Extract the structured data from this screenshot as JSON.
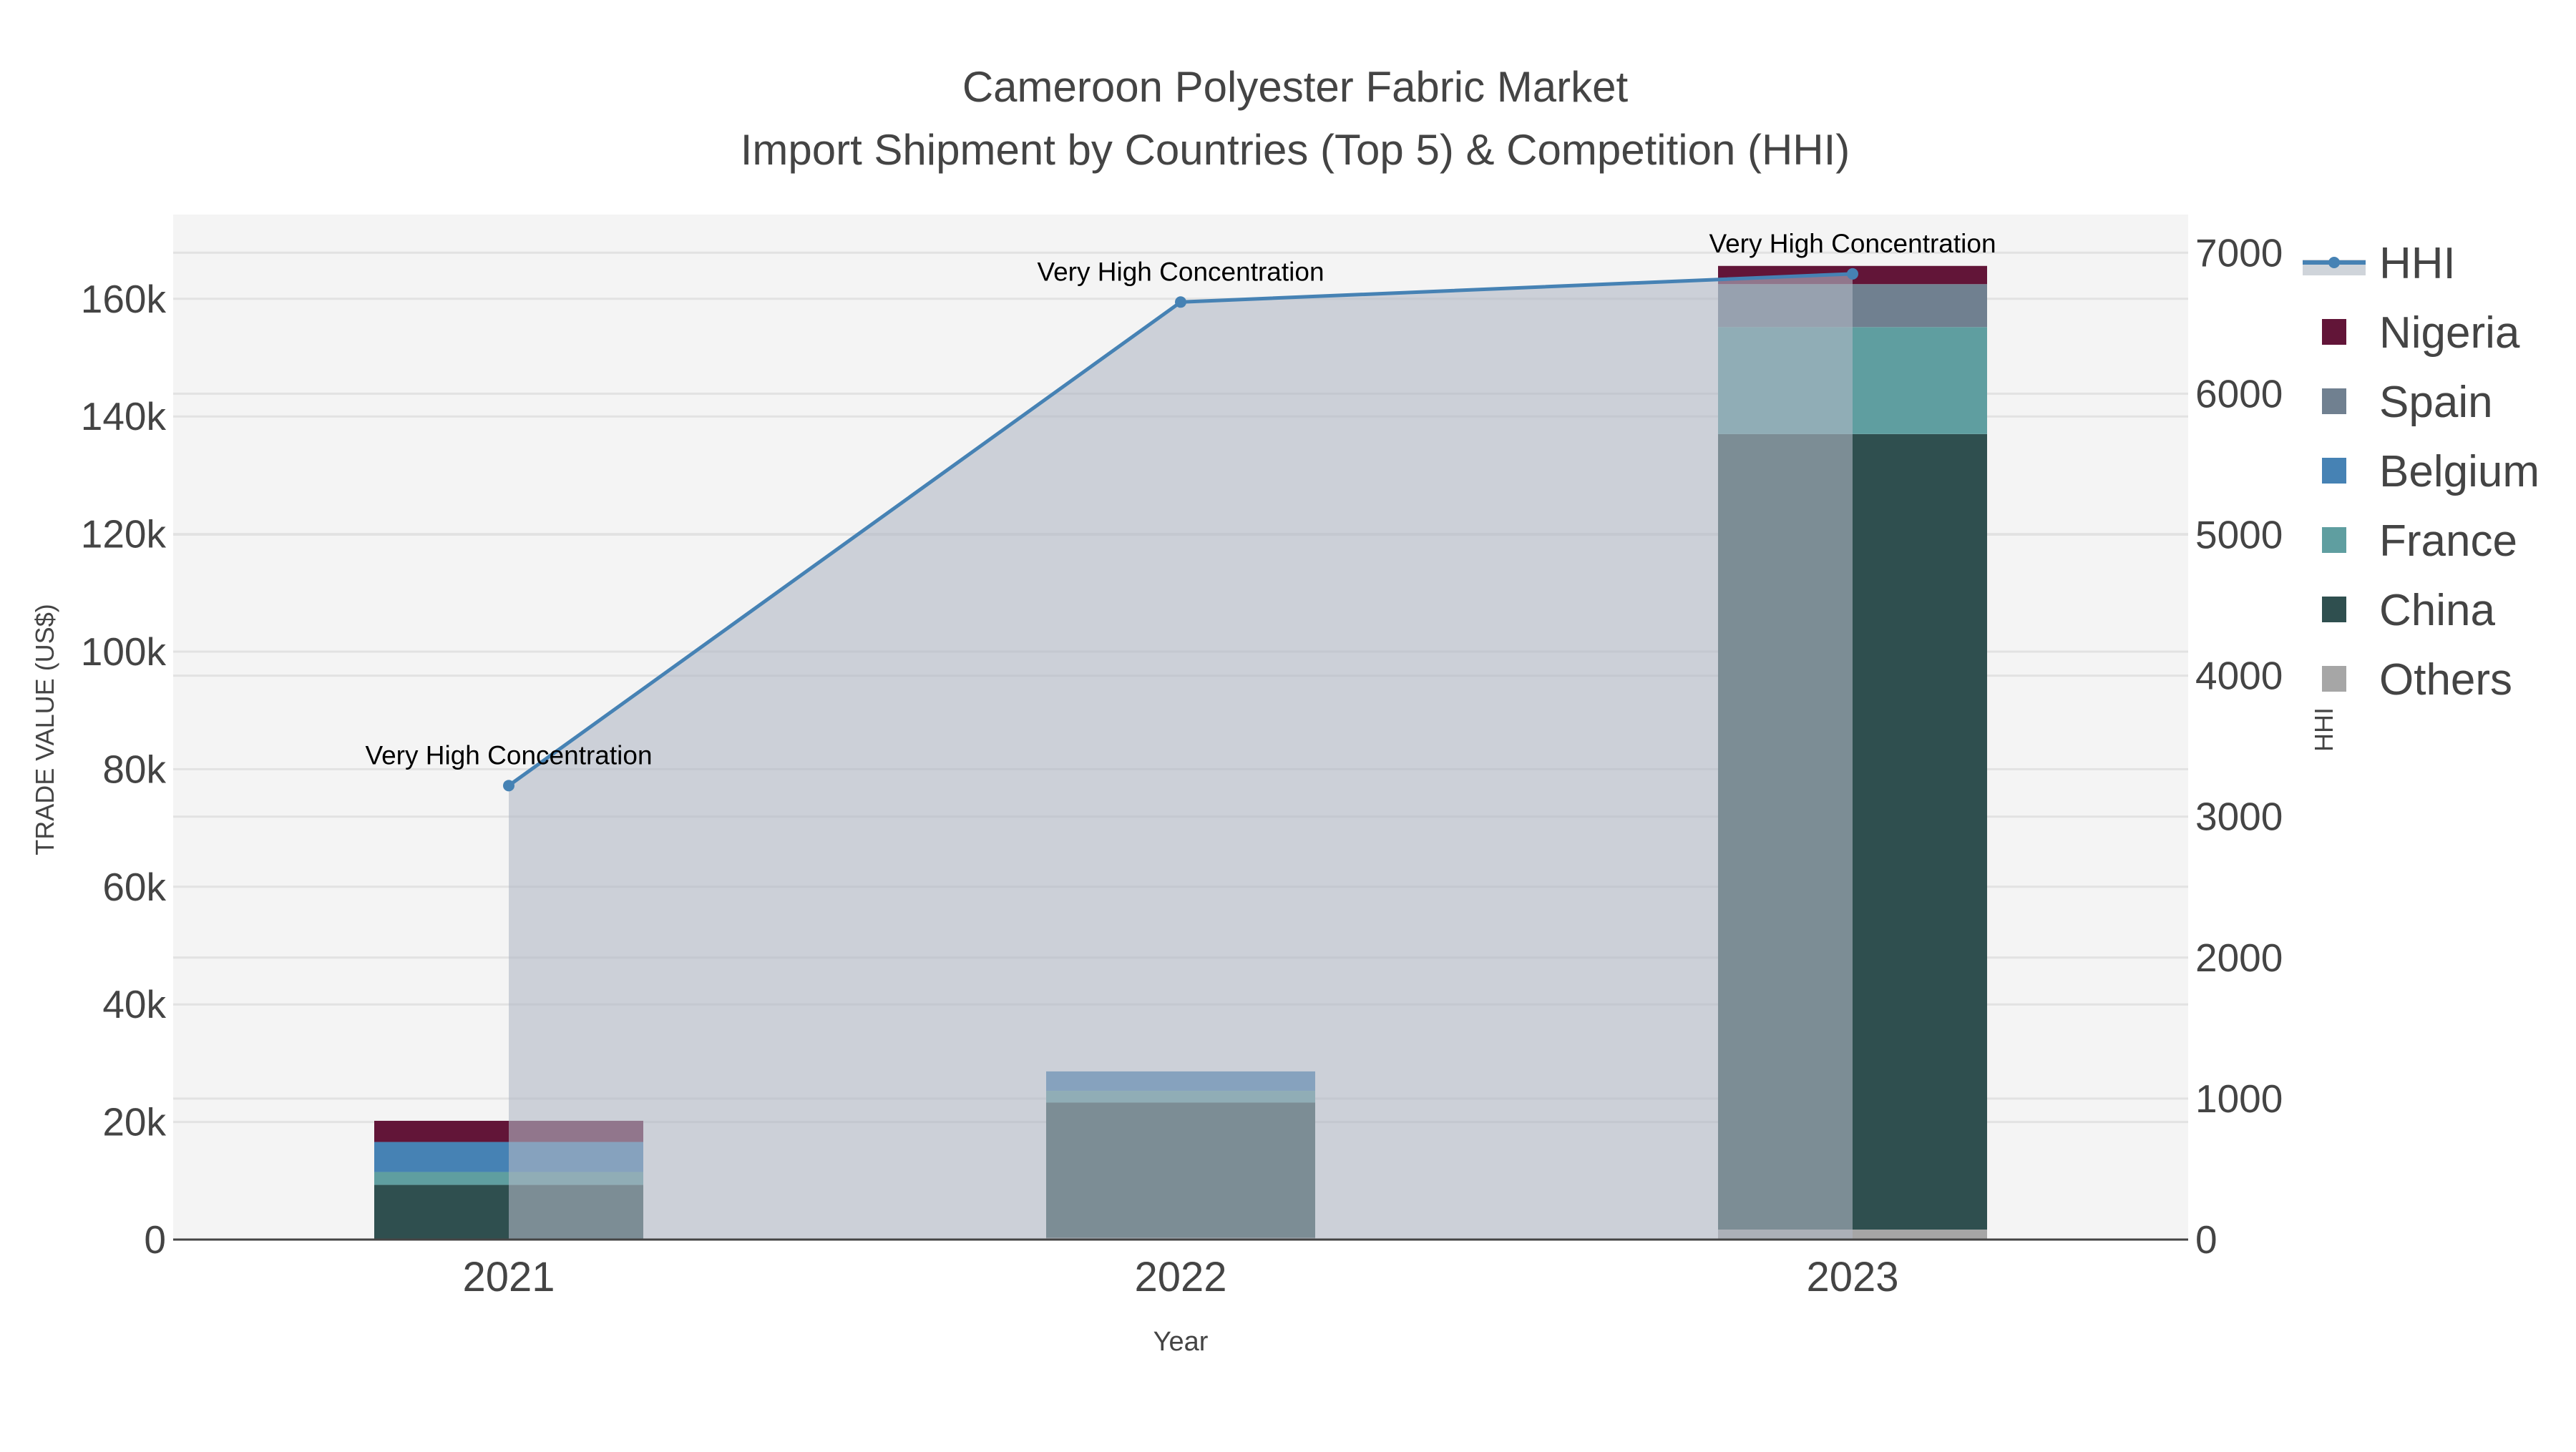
{
  "chart_data": {
    "type": "bar",
    "title": "Cameroon Polyester Fabric Market",
    "subtitle": "Import Shipment by Countries (Top 5) & Competition (HHI)",
    "xlabel": "Year",
    "ylabel": "TRADE VALUE (US$)",
    "y2label": "HHI",
    "categories": [
      "2021",
      "2022",
      "2023"
    ],
    "ylim": [
      0,
      173000
    ],
    "y2lim": [
      0,
      7260
    ],
    "yticks": [
      0,
      20000,
      40000,
      60000,
      80000,
      100000,
      120000,
      140000,
      160000
    ],
    "ytick_labels": [
      "0",
      "20k",
      "40k",
      "60k",
      "80k",
      "100k",
      "120k",
      "140k",
      "160k"
    ],
    "y2ticks": [
      0,
      1000,
      2000,
      3000,
      4000,
      5000,
      6000,
      7000
    ],
    "y2tick_labels": [
      "0",
      "1000",
      "2000",
      "3000",
      "4000",
      "5000",
      "6000",
      "7000"
    ],
    "grid": true,
    "legend_placement": "right",
    "series": [
      {
        "name": "Others",
        "color": "#a6a6a6",
        "values": [
          0,
          300,
          1700
        ]
      },
      {
        "name": "China",
        "color": "#2f4f4f",
        "values": [
          9300,
          23000,
          135300
        ]
      },
      {
        "name": "France",
        "color": "#5f9ea0",
        "values": [
          2200,
          2000,
          18200
        ]
      },
      {
        "name": "Belgium",
        "color": "#4682b4",
        "values": [
          5100,
          3300,
          0
        ]
      },
      {
        "name": "Spain",
        "color": "#708090",
        "values": [
          0,
          0,
          7300
        ]
      },
      {
        "name": "Nigeria",
        "color": "#621538",
        "values": [
          3600,
          0,
          3100
        ]
      }
    ],
    "hhi": {
      "name": "HHI",
      "color": "#4682b4",
      "values": [
        3220,
        6650,
        6850
      ]
    },
    "annotations": [
      "Very High Concentration",
      "Very High Concentration",
      "Very High Concentration"
    ],
    "legend_order": [
      "HHI",
      "Nigeria",
      "Spain",
      "Belgium",
      "France",
      "China",
      "Others"
    ]
  }
}
